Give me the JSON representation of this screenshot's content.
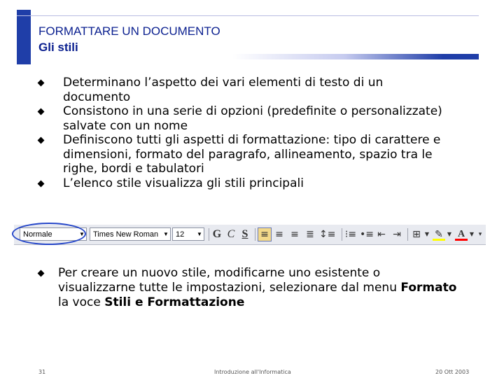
{
  "slide": {
    "title": "FORMATTARE UN DOCUMENTO",
    "subtitle": "Gli stili",
    "bullets": [
      "Determinano l’aspetto dei vari elementi di testo di un documento",
      "Consistono in una serie di opzioni (predefinite o personalizzate) salvate con un nome",
      "Definiscono tutti gli aspetti di formattazione: tipo di carattere e dimensioni, formato del paragrafo, allineamento, spazio tra le righe, bordi e tabulatori",
      "L’elenco stile visualizza gli stili principali"
    ],
    "bullet2": {
      "text_before": "Per creare un nuovo stile, modificarne uno esistente o visualizzarne tutte le impostazioni, selezionare dal menu ",
      "menu": "Formato",
      "text_mid": " la voce ",
      "item": "Stili e Formattazione"
    }
  },
  "toolbar": {
    "style_value": "Normale",
    "font_value": "Times New Roman",
    "size_value": "12",
    "bold_label": "G",
    "italic_label": "C",
    "underline_label": "S",
    "colors": {
      "highlight": "#ffff00",
      "font_color": "#ff0000",
      "accent": "#1f3ea8"
    }
  },
  "footer": {
    "page_number": "31",
    "course": "Introduzione all'Informatica",
    "date": "20 Ott 2003"
  }
}
